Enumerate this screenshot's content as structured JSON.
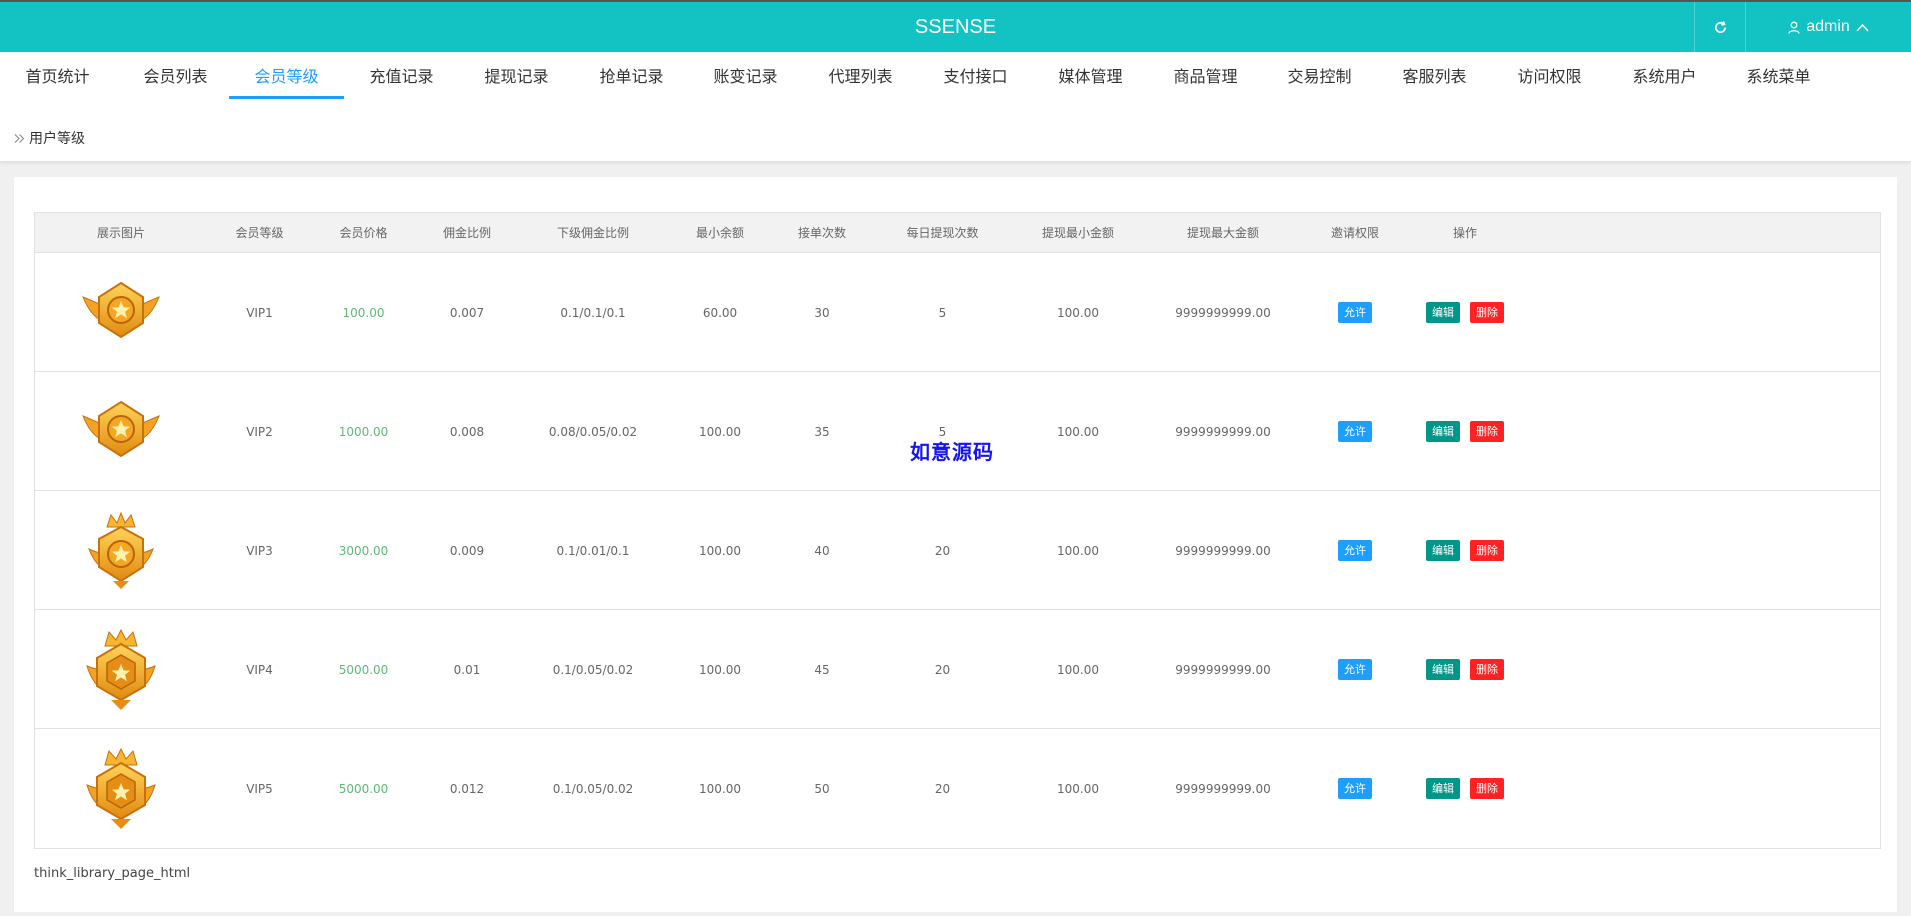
{
  "header": {
    "brand": "SSENSE",
    "user_label": "admin",
    "accent": "#13c2c3"
  },
  "nav": {
    "active_index": 2,
    "items": [
      {
        "label": "首页统计"
      },
      {
        "label": "会员列表"
      },
      {
        "label": "会员等级"
      },
      {
        "label": "充值记录"
      },
      {
        "label": "提现记录"
      },
      {
        "label": "抢单记录"
      },
      {
        "label": "账变记录"
      },
      {
        "label": "代理列表"
      },
      {
        "label": "支付接口"
      },
      {
        "label": "媒体管理"
      },
      {
        "label": "商品管理"
      },
      {
        "label": "交易控制"
      },
      {
        "label": "客服列表"
      },
      {
        "label": "访问权限"
      },
      {
        "label": "系统用户"
      },
      {
        "label": "系统菜单"
      }
    ]
  },
  "breadcrumb": {
    "current": "用户等级"
  },
  "table": {
    "columns": [
      "展示图片",
      "会员等级",
      "会员价格",
      "佣金比例",
      "下级佣金比例",
      "最小余额",
      "接单次数",
      "每日提现次数",
      "提现最小金额",
      "提现最大金额",
      "邀请权限",
      "操作"
    ],
    "rows": [
      {
        "icon": "winged-star-badge-icon",
        "level": "VIP1",
        "price": "100.00",
        "commission": "0.007",
        "sub_commission": "0.1/0.1/0.1",
        "min_balance": "60.00",
        "orders": "30",
        "daily_withdraw": "5",
        "withdraw_min": "100.00",
        "withdraw_max": "9999999999.00",
        "invite": "允许",
        "edit": "编辑",
        "delete": "删除"
      },
      {
        "icon": "winged-star-badge-icon",
        "level": "VIP2",
        "price": "1000.00",
        "commission": "0.008",
        "sub_commission": "0.08/0.05/0.02",
        "min_balance": "100.00",
        "orders": "35",
        "daily_withdraw": "5",
        "withdraw_min": "100.00",
        "withdraw_max": "9999999999.00",
        "invite": "允许",
        "edit": "编辑",
        "delete": "删除"
      },
      {
        "icon": "crowned-star-badge-icon",
        "level": "VIP3",
        "price": "3000.00",
        "commission": "0.009",
        "sub_commission": "0.1/0.01/0.1",
        "min_balance": "100.00",
        "orders": "40",
        "daily_withdraw": "20",
        "withdraw_min": "100.00",
        "withdraw_max": "9999999999.00",
        "invite": "允许",
        "edit": "编辑",
        "delete": "删除"
      },
      {
        "icon": "crowned-hexagon-badge-icon",
        "level": "VIP4",
        "price": "5000.00",
        "commission": "0.01",
        "sub_commission": "0.1/0.05/0.02",
        "min_balance": "100.00",
        "orders": "45",
        "daily_withdraw": "20",
        "withdraw_min": "100.00",
        "withdraw_max": "9999999999.00",
        "invite": "允许",
        "edit": "编辑",
        "delete": "删除"
      },
      {
        "icon": "crowned-hexagon-badge-icon",
        "level": "VIP5",
        "price": "5000.00",
        "commission": "0.012",
        "sub_commission": "0.1/0.05/0.02",
        "min_balance": "100.00",
        "orders": "50",
        "daily_withdraw": "20",
        "withdraw_min": "100.00",
        "withdraw_max": "9999999999.00",
        "invite": "允许",
        "edit": "编辑",
        "delete": "删除"
      }
    ]
  },
  "footer": {
    "note": "think_library_page_html"
  },
  "watermark": "如意源码",
  "colors": {
    "link_blue": "#1e9fff",
    "price_green": "#5fb878",
    "edit_teal": "#009688",
    "delete_red": "#ff2222"
  }
}
